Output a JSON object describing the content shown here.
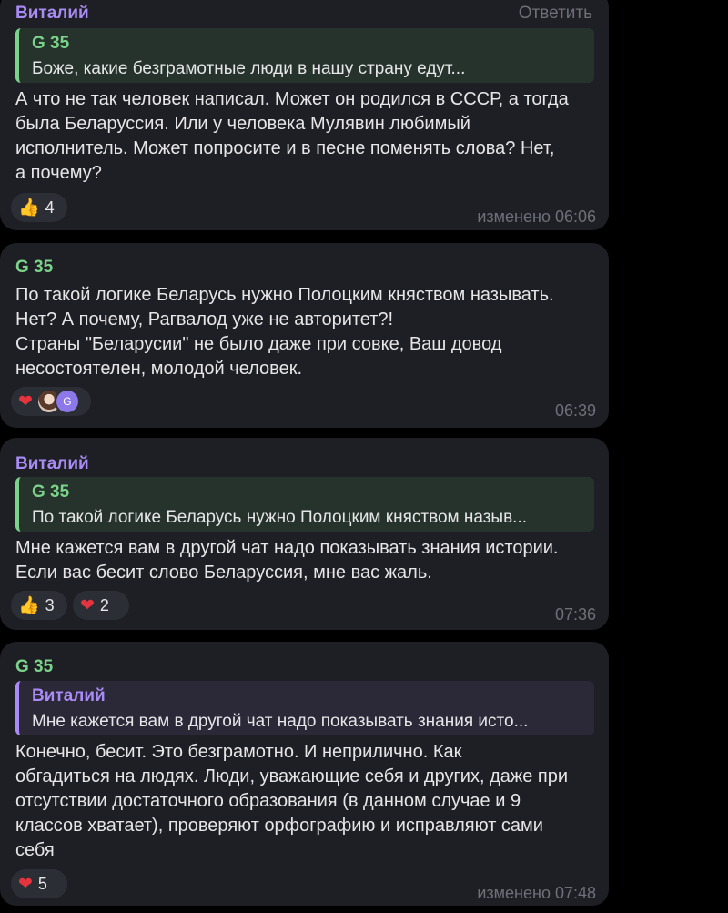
{
  "colors": {
    "background": "#000000",
    "bubble": "#1e1f24",
    "author_vitaly": "#a98bf5",
    "author_g35": "#7bd38a",
    "muted": "#6e7079"
  },
  "messages": [
    {
      "author": "Виталий",
      "reply_label": "Ответить",
      "quote_author": "G 35",
      "quote_text": "Боже, какие безграмотные люди в нашу страну едут...",
      "text": "А что не так человек написал. Может он родился в СССР, а тогда\nбыла Беларуссия. Или у человека Мулявин любимый\nисполнитель. Может попросите и в песне поменять слова? Нет,\nа почему?",
      "reaction1_icon": "👍",
      "reaction1_count": "4",
      "time": "изменено 06:06"
    },
    {
      "author": "G 35",
      "text": "По такой логике Беларусь нужно Полоцким княством называть.\nНет? А почему, Рагвалод уже не авторитет?!\nСтраны \"Беларусии\" не было даже при совке, Ваш довод\nнесостоятелен, молодой человек.",
      "reaction1_icon": "❤",
      "avatar2_letter": "G",
      "time": "06:39"
    },
    {
      "author": "Виталий",
      "quote_author": "G 35",
      "quote_text": "По такой логике Беларусь нужно Полоцким княством назыв...",
      "text": "Мне кажется вам в другой чат надо показывать  знания истории.\nЕсли вас бесит слово Беларуссия, мне вас жаль.",
      "reaction1_icon": "👍",
      "reaction1_count": "3",
      "reaction2_icon": "❤",
      "reaction2_count": "2",
      "time": "07:36"
    },
    {
      "author": "G 35",
      "quote_author": "Виталий",
      "quote_text": "Мне кажется вам в другой чат надо показывать  знания исто...",
      "text": "Конечно, бесит. Это безграмотно. И неприлично. Как\nобгадиться на людях. Люди, уважающие себя и других, даже при\nотсутствии достаточного образования (в данном случае и 9\nклассов хватает), проверяют орфографию и исправляют сами\nсебя",
      "reaction1_icon": "❤",
      "reaction1_count": "5",
      "time": "изменено 07:48"
    }
  ]
}
